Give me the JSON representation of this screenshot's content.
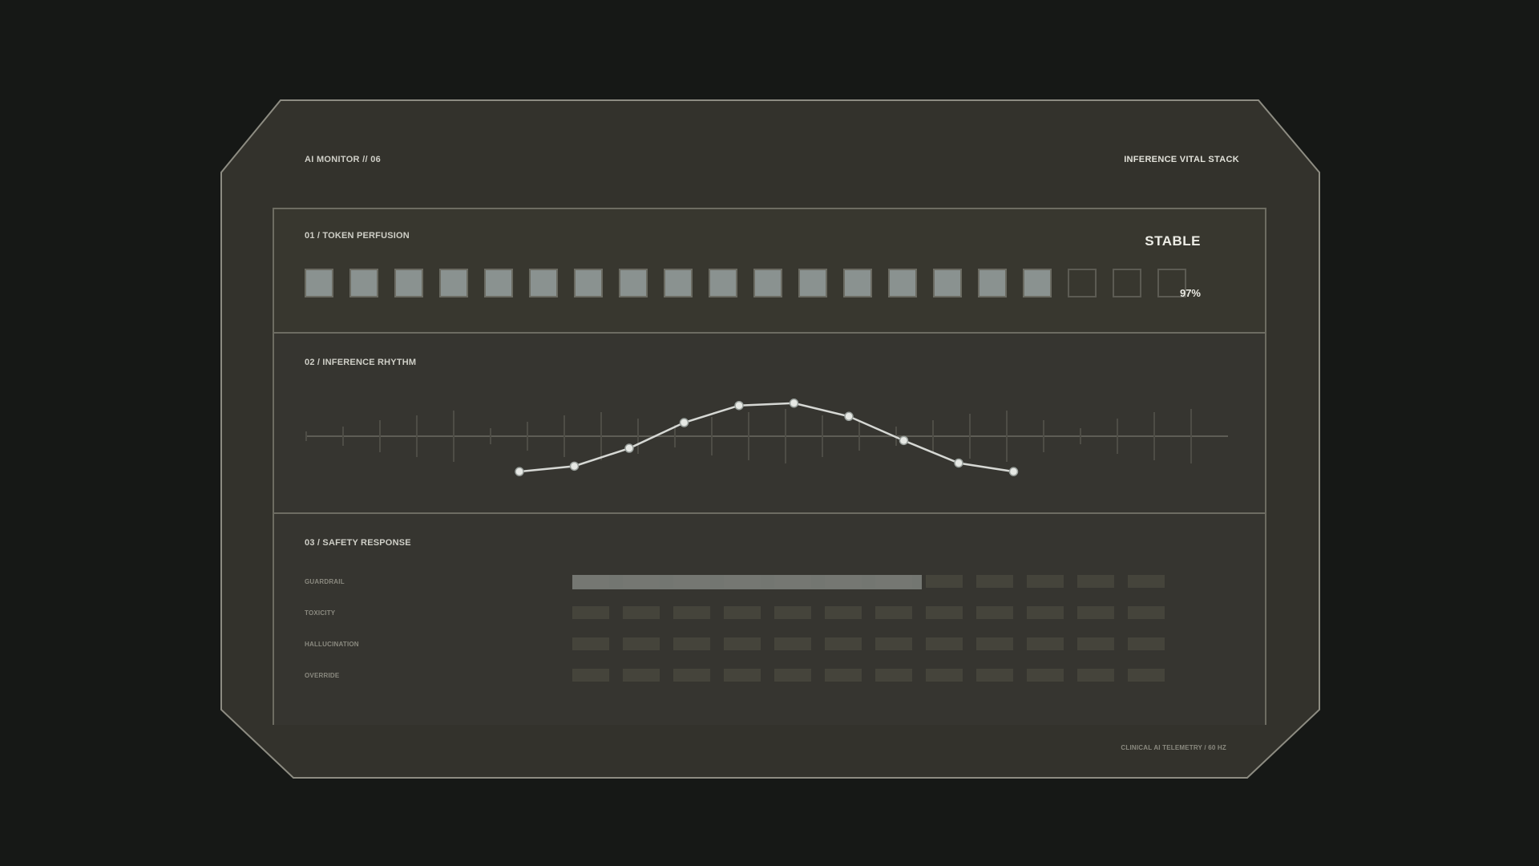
{
  "header": {
    "left_title": "AI MONITOR // 06",
    "right_title": "INFERENCE VITAL STACK"
  },
  "token_perfusion": {
    "title": "01 / TOKEN PERFUSION",
    "status": "STABLE",
    "percent_label": "97%",
    "cells_total": 20,
    "cells_active": 17
  },
  "inference_rhythm": {
    "title": "02 / INFERENCE RHYTHM"
  },
  "chart_data": {
    "type": "line",
    "x": [
      0,
      1,
      2,
      3,
      4,
      5,
      6,
      7,
      8,
      9
    ],
    "series": [
      {
        "values": [
          0.05,
          0.12,
          0.35,
          0.68,
          0.9,
          0.93,
          0.76,
          0.45,
          0.16,
          0.05
        ]
      }
    ],
    "title": "",
    "xlabel": "",
    "ylabel": "",
    "ylim": [
      0,
      1
    ],
    "grid": false
  },
  "safety_response": {
    "title": "03 / SAFETY RESPONSE",
    "rows": [
      {
        "label": "GUARDRAIL",
        "level": 0.59
      },
      {
        "label": "TOXICITY",
        "level": 0
      },
      {
        "label": "HALLUCINATION",
        "level": 0
      },
      {
        "label": "OVERRIDE",
        "level": 0
      }
    ],
    "segments_per_row": 12
  },
  "footer": {
    "text": "CLINICAL AI TELEMETRY / 60 HZ"
  },
  "colors": {
    "background": "#161816",
    "frame_fill": "#33322c",
    "frame_stroke": "#8d8c82",
    "cell_on": "#8a9290",
    "line": "#d6d8d4"
  }
}
